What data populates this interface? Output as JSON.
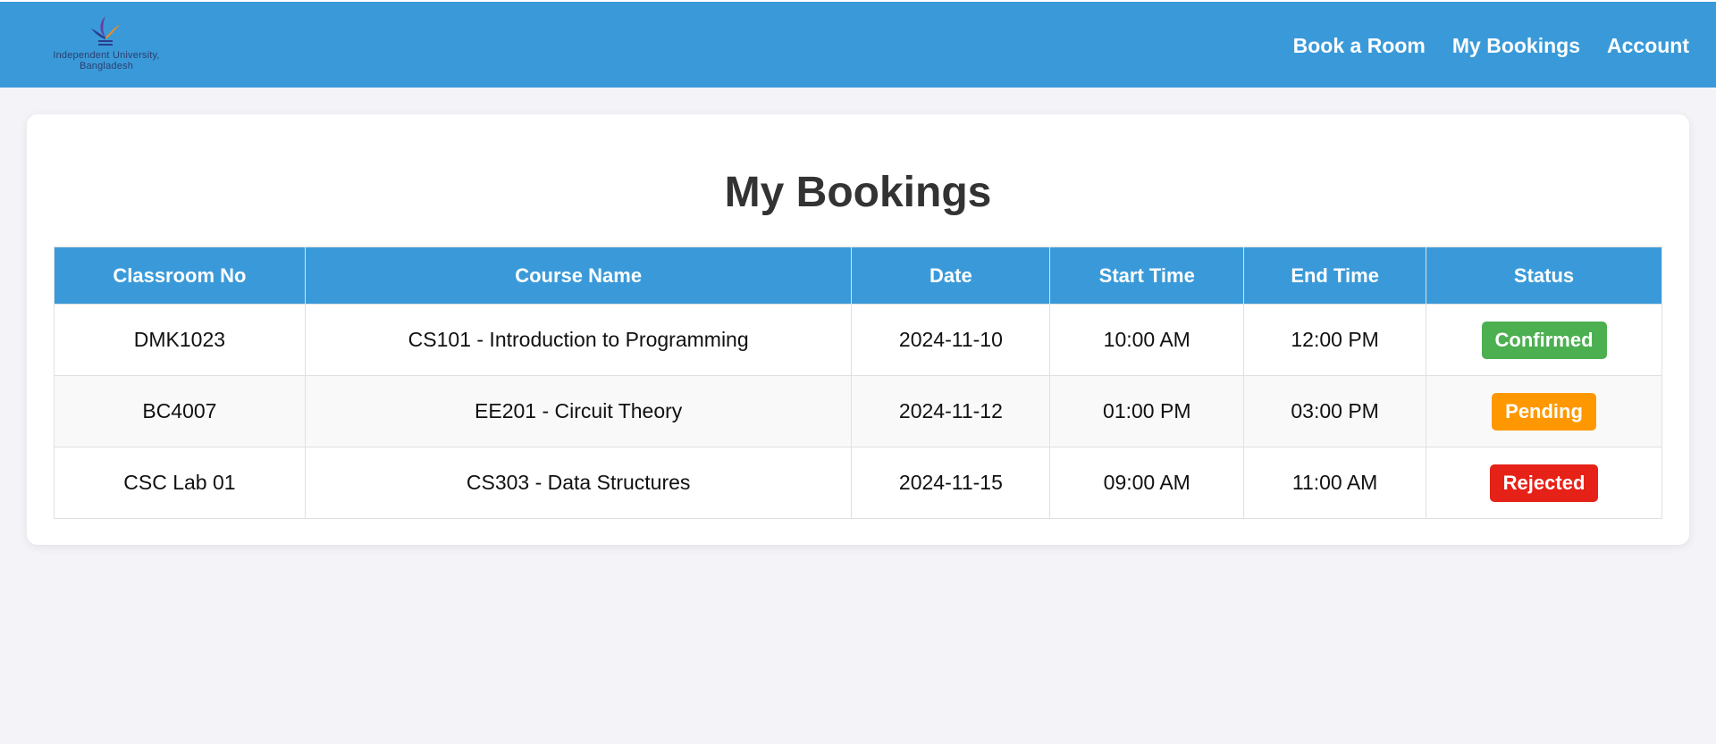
{
  "header": {
    "logo_text_line1": "Independent University,",
    "logo_text_line2": "Bangladesh",
    "nav": [
      {
        "label": "Book a Room"
      },
      {
        "label": "My Bookings"
      },
      {
        "label": "Account"
      }
    ]
  },
  "main": {
    "title": "My Bookings",
    "columns": [
      "Classroom No",
      "Course Name",
      "Date",
      "Start Time",
      "End Time",
      "Status"
    ],
    "rows": [
      {
        "classroom": "DMK1023",
        "course": "CS101 - Introduction to Programming",
        "date": "2024-11-10",
        "start": "10:00 AM",
        "end": "12:00 PM",
        "status": "Confirmed",
        "status_color": "#4caf50"
      },
      {
        "classroom": "BC4007",
        "course": "EE201 - Circuit Theory",
        "date": "2024-11-12",
        "start": "01:00 PM",
        "end": "03:00 PM",
        "status": "Pending",
        "status_color": "#ff9800"
      },
      {
        "classroom": "CSC Lab 01",
        "course": "CS303 - Data Structures",
        "date": "2024-11-15",
        "start": "09:00 AM",
        "end": "11:00 AM",
        "status": "Rejected",
        "status_color": "#e62117"
      }
    ]
  },
  "colors": {
    "header_bg": "#3a9ad9",
    "page_bg": "#f4f4f8"
  },
  "icons": {
    "logo": "university-logo-icon"
  }
}
